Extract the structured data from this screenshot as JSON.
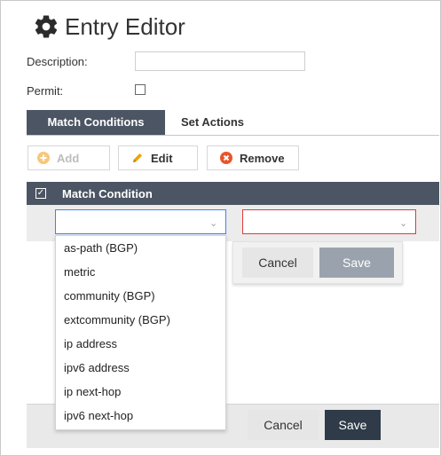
{
  "title": "Entry Editor",
  "form": {
    "description_label": "Description:",
    "description_value": "",
    "permit_label": "Permit:",
    "permit_checked": false
  },
  "tabs": [
    {
      "label": "Match Conditions",
      "active": true
    },
    {
      "label": "Set Actions",
      "active": false
    }
  ],
  "toolbar": {
    "add_label": "Add",
    "edit_label": "Edit",
    "remove_label": "Remove"
  },
  "grid": {
    "header_label": "Match Condition",
    "header_checked": true,
    "row": {
      "type_value": "",
      "value_value": ""
    }
  },
  "dropdown": {
    "options": [
      "as-path (BGP)",
      "metric",
      "community (BGP)",
      "extcommunity (BGP)",
      "ip address",
      "ipv6 address",
      "ip next-hop",
      "ipv6 next-hop"
    ]
  },
  "row_popup": {
    "cancel_label": "Cancel",
    "save_label": "Save"
  },
  "footer": {
    "cancel_label": "Cancel",
    "save_label": "Save"
  },
  "colors": {
    "header_bg": "#4b5563",
    "focus_border": "#3b82f6",
    "error_border": "#e03b3b",
    "save_dark": "#2f3b48",
    "add_icon": "#f5a623",
    "remove_icon": "#e8562a",
    "edit_icon": "#f0a000"
  }
}
